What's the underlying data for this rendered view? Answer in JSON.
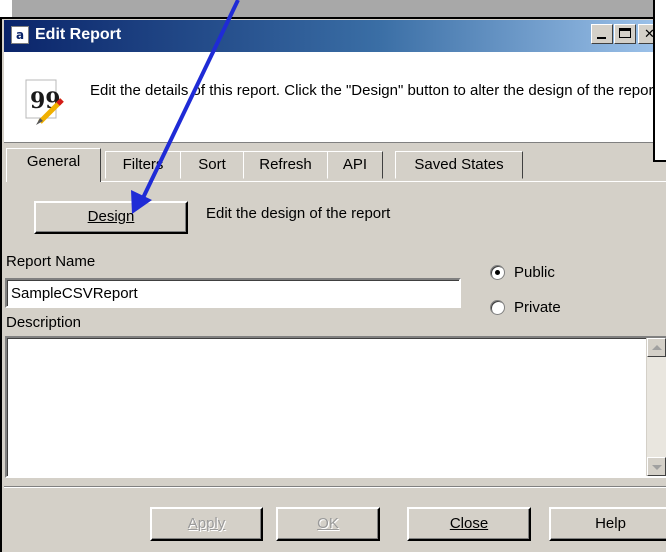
{
  "window": {
    "icon_letter": "a",
    "title": "Edit Report"
  },
  "header": {
    "icon": "quote-report-icon",
    "description": "Edit the details of this report.  Click the \"Design\" button to alter the design of the report."
  },
  "tabs": [
    {
      "label": "General",
      "active": true
    },
    {
      "label": "Filters",
      "active": false
    },
    {
      "label": "Sort",
      "active": false
    },
    {
      "label": "Refresh",
      "active": false
    },
    {
      "label": "API",
      "active": false
    },
    {
      "label": "Saved States",
      "active": false
    }
  ],
  "general": {
    "design_button_label": "Design",
    "design_hint": "Edit the design of the report",
    "report_name_label": "Report Name",
    "report_name_value": "SampleCSVReport",
    "visibility_options": [
      {
        "label": "Public",
        "selected": true
      },
      {
        "label": "Private",
        "selected": false
      }
    ],
    "description_label": "Description",
    "description_value": ""
  },
  "footer": {
    "apply_label": "Apply",
    "ok_label": "OK",
    "close_label": "Close",
    "help_label": "Help"
  },
  "colors": {
    "titlebar_start": "#0a246a",
    "titlebar_end": "#a6caf0",
    "window_bg": "#d4d0c8",
    "arrow": "#1f2bd6"
  }
}
